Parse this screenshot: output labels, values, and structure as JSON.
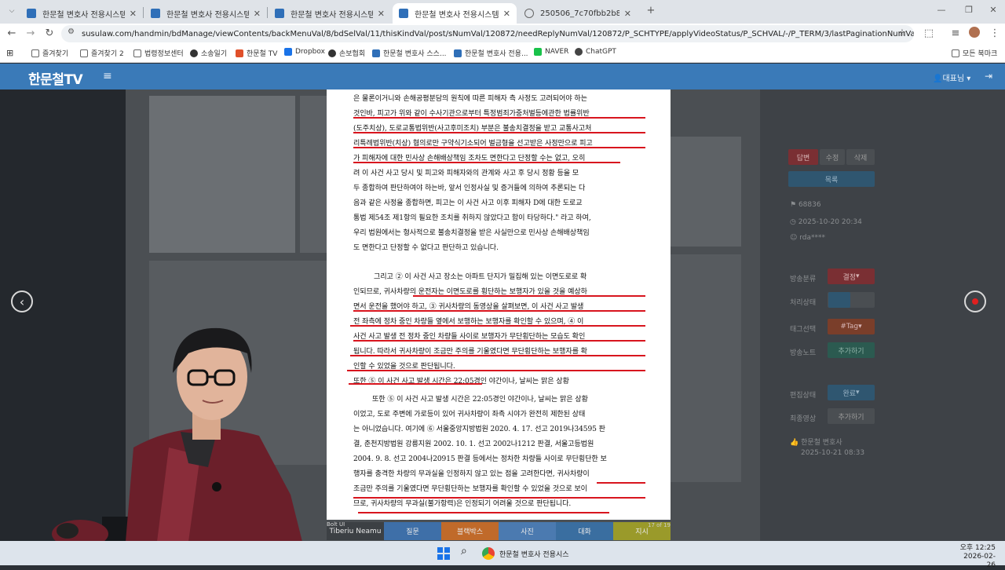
{
  "browser": {
    "tabs": [
      {
        "title": "한문철 변호사 전용시스템",
        "active": false
      },
      {
        "title": "한문철 변호사 전용시스템",
        "active": false
      },
      {
        "title": "한문철 변호사 전용시스템",
        "active": false
      },
      {
        "title": "한문철 변호사 전용시스템",
        "active": true
      },
      {
        "title": "250506_7c70fbb2b8b3bcb01e·",
        "active": false
      }
    ],
    "url": "susulaw.com/handmin/bdManage/viewContents/backMenuVal/8/bdSelVal/11/thisKindVal/post/sNumVal/120872/needReplyNumVal/120872/P_SCHTYPE/applyVideoStatus/P_SCHVAL/-/P_TERM/3/lastPaginationNumVal/1",
    "bookmarks": [
      "즐겨찾기",
      "즐겨찾기 2",
      "법령정보센터",
      "소송일기",
      "한문철 TV",
      "Dropbox",
      "손보협회",
      "한문철 변호사 스스...",
      "한문철 변호사 전용...",
      "NAVER",
      "ChatGPT"
    ],
    "all_bookmarks": "모든 북마크"
  },
  "app": {
    "logo": "한문철TV",
    "user": "대표님"
  },
  "right_panel": {
    "buttons": [
      "답변",
      "수정",
      "삭제"
    ],
    "list_button": "목록",
    "post_id": "68836",
    "post_date": "2025-10-20 20:34",
    "post_user": "rda****",
    "fields": [
      {
        "label": "방송분류",
        "value": "결정"
      },
      {
        "label": "처리상태",
        "value": ""
      },
      {
        "label": "태그선택",
        "value": "#Tag"
      },
      {
        "label": "방송노트",
        "value": "추가하기"
      },
      {
        "label": "편집상태",
        "value": "완료"
      },
      {
        "label": "최종영상",
        "value": "추가하기"
      }
    ],
    "owner": "한문철 변호사",
    "owner_date": "2025-10-21 08:33"
  },
  "document": {
    "lines": [
      "은 물론이거니와 손해공평분담의 원칙에 따른 피해자 측 사정도 고려되어야 하는",
      "것인바, 피고가 위와 같이 수사기관으로부터 특정범죄가중처벌등에관한 법률위반",
      "(도주치상), 도로교통법위반(사고후미조치) 부분은 불송치결정을 받고 교통사고처",
      "리특례법위반(치상) 혐의로만 구약식기소되어 벌금형을 선고받은 사정만으로 피고",
      "가 피해자에 대한 민사상 손해배상책임 조차도 면한다고 단정할 수는 없고, 오히",
      "려 이 사건 사고 당시 및 피고와 피해자와의 관계와 사고 후 당시 정황 등을 모",
      "두 종합하여 판단하여야 하는바, 앞서 인정사실 및 증거들에 의하여 추론되는 다",
      "음과 같은 사정을 종합하면, 피고는 이 사건 사고 이후 피해자 D에 대한 도로교",
      "통법 제54조 제1항의 필요한 조치를 취하지 않았다고 함이 타당하다.\" 라고 하여,",
      "우리 법원에서는 형사적으로 불송치결정을 받은 사실만으로 민사상 손해배상책임",
      "도 면한다고 단정할 수 없다고 판단하고 있습니다.",
      "그리고 ② 이 사건 사고 장소는 아파트 단지가 밀집해 있는 이면도로로 확",
      "인되므로, 귀사차량의 운전자는 이면도로를 횡단하는 보행자가 있을 것을 예상하",
      "면서 운전을 했어야 하고, ③ 귀사차량의 동영상을 살펴보면, 이 사건 사고 발생",
      "전 좌측에 정차 중인 차량들 옆에서 보행하는 보행자를 확인할 수 있으며, ④ 이",
      "사건 사고 발생 전 정차 중인 차량들 사이로 보행자가 무단횡단하는 모습도 확인",
      "됩니다. 따라서 귀사차량이 조금만 주의를 기울였다면 무단횡단하는 보행자를 확",
      "인할 수 있었을 것으로 판단됩니다.",
      "또한 ⑤ 이 사건 사고 발생 시간은 22:05경인 야간이나, 날씨는 맑은 상황",
      "이었고, 도로 주변에 가로등이 있어 귀사차량이 좌측 시야가 완전히 제한된 상태",
      "는 아니었습니다. 여기에 ⑥ 서울중앙지방법원 2020. 4. 17. 선고 2019나34595 판",
      "결, 춘천지방법원 강릉지원 2002. 10. 1. 선고 2002나1212 판결, 서울고등법원",
      "2004. 9. 8. 선고 2004나20915 판결 등에서는 정차한 차량들 사이로 무단횡단한 보",
      "행자를 충격한 차량의 무과실을 인정하지 않고 있는 점을 고려한다면, 귀사차량이",
      "조금만 주의를 기울였다면 무단횡단하는 보행자를 확인할 수 있었을 것으로 보이",
      "므로, 귀사차량의 무과실(불가항력)은 인정되기 어려울 것으로 판단됩니다."
    ],
    "page_counter": "17 of 19",
    "overlay_label": "Bolt UI"
  },
  "bottom_tabs": [
    "Tiberiu Neamu",
    "질문",
    "블랙박스",
    "사진",
    "대화",
    "지시"
  ],
  "taskbar": {
    "app_title": "한문철 변호사 전용시스",
    "time": "오후 12:25",
    "date": "2026-02-26"
  },
  "colors": {
    "header_blue": "#3a7ab8",
    "underline_red": "#d8151e"
  }
}
